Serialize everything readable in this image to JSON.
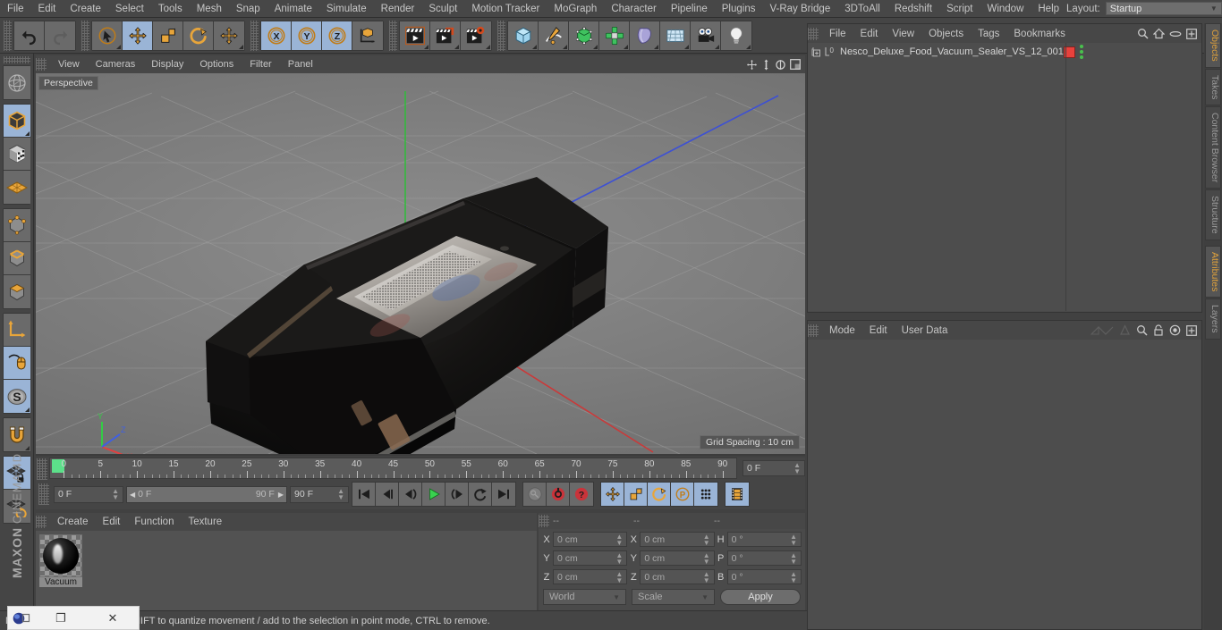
{
  "menubar": {
    "items": [
      "File",
      "Edit",
      "Create",
      "Select",
      "Tools",
      "Mesh",
      "Snap",
      "Animate",
      "Simulate",
      "Render",
      "Sculpt",
      "Motion Tracker",
      "MoGraph",
      "Character",
      "Pipeline",
      "Plugins",
      "V-Ray Bridge",
      "3DToAll",
      "Redshift",
      "Script",
      "Window",
      "Help"
    ],
    "layout_label": "Layout:",
    "layout_value": "Startup",
    "search_icon": "search-icon"
  },
  "toolbar": {
    "groups": [
      {
        "name": "history",
        "buttons": [
          {
            "name": "undo-button",
            "icon": "undo-arrow-icon",
            "active": false,
            "corner": false
          },
          {
            "name": "redo-button",
            "icon": "redo-arrow-icon",
            "active": false,
            "corner": false
          }
        ]
      },
      {
        "name": "transform",
        "buttons": [
          {
            "name": "live-selection-button",
            "icon": "cursor-circle-icon",
            "active": false,
            "corner": true
          },
          {
            "name": "move-button",
            "icon": "move-arrows-icon",
            "active": true,
            "corner": false
          },
          {
            "name": "scale-button",
            "icon": "scale-box-icon",
            "active": false,
            "corner": false
          },
          {
            "name": "rotate-button",
            "icon": "rotate-circle-icon",
            "active": false,
            "corner": false
          },
          {
            "name": "move-duplicate-button",
            "icon": "move-arrows-icon",
            "active": false,
            "corner": true
          }
        ]
      },
      {
        "name": "axis-locks",
        "buttons": [
          {
            "name": "lock-x-button",
            "icon": "x-axis-icon",
            "active": true,
            "corner": false
          },
          {
            "name": "lock-y-button",
            "icon": "y-axis-icon",
            "active": true,
            "corner": false
          },
          {
            "name": "lock-z-button",
            "icon": "z-axis-icon",
            "active": true,
            "corner": false
          },
          {
            "name": "world-object-coord-button",
            "icon": "axis-cube-icon",
            "active": false,
            "corner": false
          }
        ]
      },
      {
        "name": "render",
        "buttons": [
          {
            "name": "render-view-button",
            "icon": "clapper-icon",
            "active": false,
            "corner": true
          },
          {
            "name": "render-to-picture-viewer-button",
            "icon": "clapper-picture-icon",
            "active": false,
            "corner": true
          },
          {
            "name": "render-settings-button",
            "icon": "clapper-gear-icon",
            "active": false,
            "corner": true
          }
        ]
      },
      {
        "name": "objects",
        "buttons": [
          {
            "name": "add-cube-button",
            "icon": "cube-icon",
            "active": false,
            "corner": true
          },
          {
            "name": "add-spline-button",
            "icon": "pen-spline-icon",
            "active": false,
            "corner": true
          },
          {
            "name": "add-nurbs-button",
            "icon": "green-cube-icon",
            "active": false,
            "corner": true
          },
          {
            "name": "add-array-button",
            "icon": "cloner-icon",
            "active": false,
            "corner": true
          },
          {
            "name": "add-deformer-button",
            "icon": "bend-deformer-icon",
            "active": false,
            "corner": true
          },
          {
            "name": "add-scene-object-button",
            "icon": "floor-grid-icon",
            "active": false,
            "corner": true
          },
          {
            "name": "add-camera-button",
            "icon": "camera-icon",
            "active": false,
            "corner": true
          },
          {
            "name": "add-light-button",
            "icon": "light-bulb-icon",
            "active": false,
            "corner": true
          }
        ]
      }
    ]
  },
  "left_toolbar": {
    "groups": [
      [
        {
          "name": "make-editable-button",
          "icon": "globe-mesh-icon",
          "active": false,
          "corner": false
        }
      ],
      [
        {
          "name": "model-mode-button",
          "icon": "model-cube-icon",
          "active": true,
          "corner": true
        },
        {
          "name": "texture-mode-button",
          "icon": "texture-checker-cube-icon",
          "active": false,
          "corner": false
        },
        {
          "name": "workplane-mode-button",
          "icon": "workplane-grid-icon",
          "active": false,
          "corner": false
        }
      ],
      [
        {
          "name": "points-mode-button",
          "icon": "points-cube-icon",
          "active": false,
          "corner": false
        },
        {
          "name": "edges-mode-button",
          "icon": "edges-cube-icon",
          "active": false,
          "corner": false
        },
        {
          "name": "polygons-mode-button",
          "icon": "polygon-cube-icon",
          "active": false,
          "corner": false
        }
      ],
      [
        {
          "name": "object-axis-button",
          "icon": "axis-arrow-icon",
          "active": false,
          "corner": false
        },
        {
          "name": "viewport-solo-button",
          "icon": "mouse-icon",
          "active": true,
          "corner": false
        },
        {
          "name": "enable-snap-button",
          "icon": "snap-s-icon",
          "active": true,
          "corner": true
        }
      ],
      [
        {
          "name": "magnet-button",
          "icon": "magnet-icon",
          "active": false,
          "corner": true
        }
      ],
      [
        {
          "name": "lock-workplane-button",
          "icon": "workplane-lock-icon",
          "active": true,
          "corner": false
        },
        {
          "name": "planar-workplane-button",
          "icon": "workplane-rotate-icon",
          "active": false,
          "corner": false
        }
      ]
    ],
    "brand_line1": "MAXON",
    "brand_line2": "CINEMA 4D"
  },
  "viewport": {
    "menu_items": [
      "View",
      "Cameras",
      "Display",
      "Options",
      "Filter",
      "Panel"
    ],
    "right_icons": [
      "move-camera-icon",
      "dolly-camera-icon",
      "rotate-camera-icon",
      "maximize-viewport-icon"
    ],
    "label": "Perspective",
    "grid_spacing": "Grid Spacing : 10 cm",
    "axis_gizmo": {
      "x": "X",
      "y": "Y",
      "z": "Z"
    },
    "model_name": "Nesco Deluxe Food Vacuum Sealer VS 12"
  },
  "timeline": {
    "ticks": [
      0,
      5,
      10,
      15,
      20,
      25,
      30,
      35,
      40,
      45,
      50,
      55,
      60,
      65,
      70,
      75,
      80,
      85,
      90
    ],
    "current_frame_right": "0 F",
    "current_frame": "0 F",
    "range_start": "0 F",
    "range_end": "90 F",
    "end_frame": "90 F",
    "transport": [
      {
        "name": "go-to-start-button",
        "icon": "skip-start-icon",
        "active": false
      },
      {
        "name": "play-backwards-step-button",
        "icon": "rewind-icon",
        "active": false
      },
      {
        "name": "step-back-button",
        "icon": "prev-frame-icon",
        "active": false
      },
      {
        "name": "play-button",
        "icon": "play-icon",
        "active": false
      },
      {
        "name": "step-forward-button",
        "icon": "next-frame-icon",
        "active": false
      },
      {
        "name": "loop-button",
        "icon": "loop-icon",
        "active": false
      },
      {
        "name": "go-to-end-button",
        "icon": "skip-end-icon",
        "active": false
      }
    ],
    "keys": [
      {
        "name": "autokeying-button",
        "icon": "key-icon",
        "active": false
      },
      {
        "name": "record-active-objects-button",
        "icon": "record-icon",
        "active": false
      },
      {
        "name": "keyframe-selection-button",
        "icon": "question-key-icon",
        "active": false
      }
    ],
    "key_filters": [
      {
        "name": "position-key-button",
        "icon": "move-arrows-icon",
        "active": true
      },
      {
        "name": "scale-key-button",
        "icon": "scale-box-icon",
        "active": true
      },
      {
        "name": "rotation-key-button",
        "icon": "rotate-circle-icon",
        "active": true
      },
      {
        "name": "parameter-key-button",
        "icon": "parameter-p-icon",
        "active": true
      },
      {
        "name": "point-level-animation-button",
        "icon": "pla-dots-icon",
        "active": true
      }
    ],
    "extra": [
      {
        "name": "timeline-view-button",
        "icon": "film-strip-icon",
        "active": true
      }
    ]
  },
  "material_manager": {
    "menu_items": [
      "Create",
      "Edit",
      "Function",
      "Texture"
    ],
    "materials": [
      {
        "name": "Vacuum"
      }
    ]
  },
  "coordinates": {
    "headers": [
      "--",
      "--",
      "--"
    ],
    "rows": [
      {
        "pos_label": "X",
        "pos_value": "0 cm",
        "size_label": "X",
        "size_value": "0 cm",
        "rot_label": "H",
        "rot_value": "0 °"
      },
      {
        "pos_label": "Y",
        "pos_value": "0 cm",
        "size_label": "Y",
        "size_value": "0 cm",
        "rot_label": "P",
        "rot_value": "0 °"
      },
      {
        "pos_label": "Z",
        "pos_value": "0 cm",
        "size_label": "Z",
        "size_value": "0 cm",
        "rot_label": "B",
        "rot_value": "0 °"
      }
    ],
    "coord_system": "World",
    "mode": "Scale",
    "apply_label": "Apply"
  },
  "object_manager": {
    "menu_items": [
      "File",
      "Edit",
      "View",
      "Objects",
      "Tags",
      "Bookmarks"
    ],
    "header_icons": [
      "search-icon",
      "home-icon",
      "ellipse-icon",
      "plus-box-icon"
    ],
    "object_name": "Nesco_Deluxe_Food_Vacuum_Sealer_VS_12_001",
    "tag_color": "#e8413c"
  },
  "attributes": {
    "menu_items": [
      "Mode",
      "Edit",
      "User Data"
    ],
    "header_icons": [
      "interpolation-icon",
      "cone-icon",
      "search-icon",
      "lock-icon",
      "target-icon",
      "plus-box-icon"
    ]
  },
  "right_tabs": {
    "upper": [
      {
        "label": "Objects",
        "selected": true
      },
      {
        "label": "Takes",
        "selected": false
      },
      {
        "label": "Content Browser",
        "selected": false
      },
      {
        "label": "Structure",
        "selected": false
      }
    ],
    "lower": [
      {
        "label": "Attributes",
        "selected": true
      },
      {
        "label": "Layers",
        "selected": false
      }
    ]
  },
  "statusbar": {
    "text": "Move elements. Hold down SHIFT to quantize movement / add to the selection in point mode, CTRL to remove."
  },
  "taskbar_window": {
    "restore_label": "❐",
    "close_label": "✕"
  }
}
